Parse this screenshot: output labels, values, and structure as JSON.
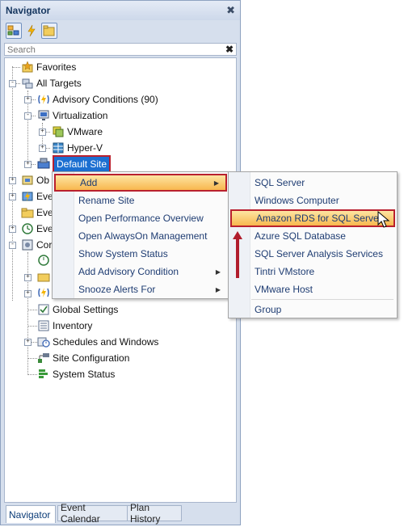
{
  "panel": {
    "title": "Navigator",
    "close_glyph": "✖"
  },
  "search": {
    "placeholder": "Search",
    "clear_glyph": "✖"
  },
  "toolbar": {
    "icons": [
      "tree-view-icon",
      "lightning-icon",
      "folder-icon"
    ]
  },
  "tree": {
    "favorites": "Favorites",
    "all_targets": "All Targets",
    "advisory_conditions": "Advisory Conditions (90)",
    "virtualization": "Virtualization",
    "vmware": "VMware",
    "hyperv": "Hyper-V",
    "default_site": "Default Site",
    "obj_partial": "Ob",
    "eve1_partial": "Eve",
    "eve2_partial": "Eve",
    "eve3_partial": "Eve",
    "con_partial": "Cor",
    "global_settings": "Global Settings",
    "inventory": "Inventory",
    "schedules": "Schedules and Windows",
    "site_config": "Site Configuration",
    "system_status": "System Status"
  },
  "context_menu": {
    "items": [
      {
        "label": "Add",
        "submenu": true
      },
      {
        "label": "Rename Site",
        "submenu": false
      },
      {
        "label": "Open Performance Overview",
        "submenu": false
      },
      {
        "label": "Open AlwaysOn Management",
        "submenu": false
      },
      {
        "label": "Show System Status",
        "submenu": false
      },
      {
        "label": "Add Advisory Condition",
        "submenu": true
      },
      {
        "label": "Snooze Alerts For",
        "submenu": true
      }
    ]
  },
  "submenu": {
    "items": [
      "SQL Server",
      "Windows Computer",
      "Amazon RDS for SQL Server",
      "Azure SQL Database",
      "SQL Server Analysis Services",
      "Tintri VMstore",
      "VMware Host",
      "Group"
    ]
  },
  "tabs": [
    "Navigator",
    "Event Calendar",
    "Plan History"
  ],
  "colors": {
    "highlight_border": "#b9202e",
    "selection_blue": "#1c6fd1",
    "menu_highlight": "#f8b74e"
  }
}
